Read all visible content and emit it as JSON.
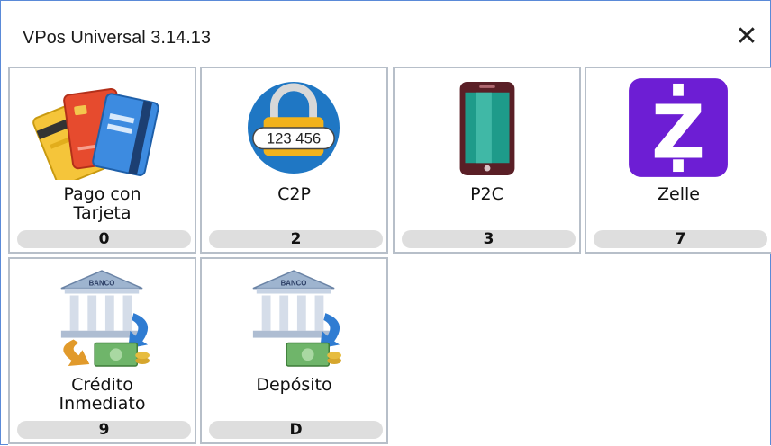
{
  "window": {
    "title": "VPos Universal 3.14.13",
    "close_glyph": "✕"
  },
  "methods": [
    {
      "label_lines": [
        "Pago con",
        "Tarjeta"
      ],
      "shortcut": "0",
      "icon": "credit-cards-icon"
    },
    {
      "label_lines": [
        "C2P"
      ],
      "shortcut": "2",
      "icon": "padlock-code-icon",
      "icon_text": "123 456"
    },
    {
      "label_lines": [
        "P2C"
      ],
      "shortcut": "3",
      "icon": "smartphone-icon"
    },
    {
      "label_lines": [
        "Zelle"
      ],
      "shortcut": "7",
      "icon": "zelle-logo-icon",
      "icon_text": "Z"
    },
    {
      "label_lines": [
        "Crédito",
        "Inmediato"
      ],
      "shortcut": "9",
      "icon": "bank-transfer-icon",
      "icon_text": "BANCO"
    },
    {
      "label_lines": [
        "Depósito"
      ],
      "shortcut": "D",
      "icon": "bank-deposit-icon",
      "icon_text": "BANCO"
    }
  ],
  "colors": {
    "window_border": "#5a8ad8",
    "tile_border": "#b7bfc9",
    "shortcut_bg": "#dedede",
    "zelle": "#6d1ed4",
    "c2p_blue": "#1f77c4",
    "c2p_lock": "#f2b21b"
  }
}
